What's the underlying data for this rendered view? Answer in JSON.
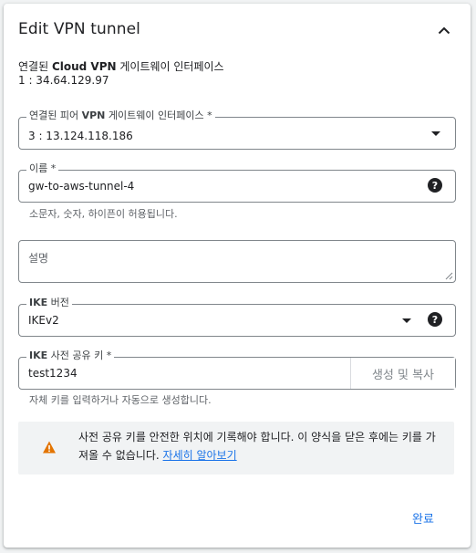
{
  "dialog": {
    "title": "Edit VPN tunnel",
    "collapse_icon": "chevron-up-icon"
  },
  "cloud_gateway": {
    "label_prefix": "연결된 ",
    "label_bold": "Cloud VPN",
    "label_suffix": " 게이트웨이 인터페이스",
    "value": "1 : 34.64.129.97"
  },
  "peer_gateway": {
    "label_prefix": "연결된 피어 ",
    "label_bold": "VPN",
    "label_suffix": " 게이트웨이 인터페이스 *",
    "selected": "3 : 13.124.118.186",
    "icon": "dropdown-arrow-icon"
  },
  "name_field": {
    "label": "이름 *",
    "value": "gw-to-aws-tunnel-4",
    "hint": "소문자, 숫자, 하이픈이 허용됩니다.",
    "help_icon": "help-icon"
  },
  "description_field": {
    "placeholder": "설명",
    "value": ""
  },
  "ike_version": {
    "label_bold": "IKE",
    "label_suffix": " 버전",
    "selected": "IKEv2",
    "help_icon": "help-icon"
  },
  "ike_psk": {
    "label_bold": "IKE",
    "label_suffix": " 사전 공유 키 *",
    "value": "test1234",
    "generate_button": "생성 및 복사",
    "hint": "자체 키를 입력하거나 자동으로 생성합니다."
  },
  "warning": {
    "icon": "warning-icon",
    "text": "사전 공유 키를 안전한 위치에 기록해야 합니다. 이 양식을 닫은 후에는 키를 가져올 수 없습니다. ",
    "link": "자세히 알아보기",
    "color": "#e37400"
  },
  "actions": {
    "done_label": "완료"
  },
  "colors": {
    "accent": "#1a73e8",
    "border": "#80868b",
    "background": "#f1f3f4"
  }
}
